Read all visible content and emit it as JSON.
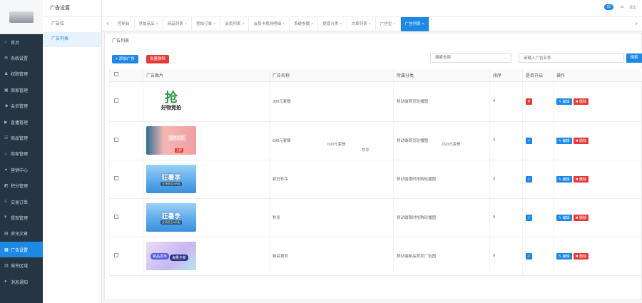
{
  "sidebar": {
    "items": [
      {
        "icon": "home-icon",
        "glyph": "⌂",
        "label": "首页"
      },
      {
        "icon": "gear-icon",
        "glyph": "⚙",
        "label": "系统设置"
      },
      {
        "icon": "users-icon",
        "glyph": "♟",
        "label": "权限管理"
      },
      {
        "icon": "shop-icon",
        "glyph": "▣",
        "label": "商家管理"
      },
      {
        "icon": "member-icon",
        "glyph": "☻",
        "label": "会员管理"
      },
      {
        "icon": "video-icon",
        "glyph": "▶",
        "label": "直播管理"
      },
      {
        "icon": "goods-icon",
        "glyph": "☷",
        "label": "商品管理"
      },
      {
        "icon": "store-icon",
        "glyph": "⌂",
        "label": "商家管理"
      },
      {
        "icon": "marketing-icon",
        "glyph": "✦",
        "label": "营销中心"
      },
      {
        "icon": "points-icon",
        "glyph": "◩",
        "label": "积分管理"
      },
      {
        "icon": "order-icon",
        "glyph": "≡",
        "label": "交易订单"
      },
      {
        "icon": "yen-icon",
        "glyph": "¥",
        "label": "提现管理"
      },
      {
        "icon": "article-icon",
        "glyph": "▤",
        "label": "资讯文章"
      },
      {
        "icon": "ad-icon",
        "glyph": "▦",
        "label": "广告设置"
      },
      {
        "icon": "region-icon",
        "glyph": "▥",
        "label": "城市区域"
      },
      {
        "icon": "notice-icon",
        "glyph": "●",
        "label": "消息通知"
      }
    ],
    "active_index": 13
  },
  "subnav": {
    "title": "广告设置",
    "items": [
      {
        "label": "广告位"
      },
      {
        "label": "广告列表"
      }
    ]
  },
  "topbar": {
    "badge": "10",
    "logout_label": "退出"
  },
  "tabs": [
    {
      "label": "控制台",
      "closable": false
    },
    {
      "label": "竞拍商品",
      "closable": true
    },
    {
      "label": "商品列表",
      "closable": true
    },
    {
      "label": "竞拍订单",
      "closable": true
    },
    {
      "label": "会员列表",
      "closable": true
    },
    {
      "label": "会员卡规则明细",
      "closable": true
    },
    {
      "label": "系统参数",
      "closable": true
    },
    {
      "label": "提现分类",
      "closable": true
    },
    {
      "label": "文章列表",
      "closable": true
    },
    {
      "label": "广告位",
      "closable": true
    },
    {
      "label": "广告列表",
      "closable": true,
      "active": true
    }
  ],
  "panel": {
    "title": "广告列表",
    "add_button": "+ 添加广告",
    "batch_delete_button": "批量删除",
    "select_value": "搜索全部",
    "search_placeholder": "请输入广告名称",
    "search_button": "搜索"
  },
  "table": {
    "headers": [
      "",
      "广告图片",
      "广告名称",
      "所属分类",
      "排序",
      "是否开启",
      "操作"
    ],
    "rows": [
      {
        "name": "390元套餐",
        "category": "移动端首页轮播图",
        "sort": "4",
        "enabled": false,
        "thumb": {
          "style": "logo",
          "line1": "抢",
          "line2": "好物竞拍"
        }
      },
      {
        "name": "690元套餐",
        "category": "移动端首页轮播图",
        "sort": "3",
        "enabled": true,
        "thumb": {
          "style": "banner",
          "line1": "服务之星",
          "line2": "立即"
        }
      },
      {
        "name": "疯狂秒杀",
        "category": "移动端限时抢购轮播图",
        "sort": "0",
        "enabled": true,
        "thumb": {
          "style": "summer",
          "line1": "狂暑季",
          "line2": "全场低至5折起"
        }
      },
      {
        "name": "秒杀",
        "category": "移动端限时抢购轮播图",
        "sort": "0",
        "enabled": true,
        "thumb": {
          "style": "summer",
          "line1": "狂暑季",
          "line2": "全场低至5折起"
        }
      },
      {
        "name": "新品首发",
        "category": "移动端新品首发广告图",
        "sort": "0",
        "enabled": true,
        "thumb": {
          "style": "newgoods",
          "line1": "新品发布",
          "line2": "海量全新"
        }
      }
    ],
    "edit_label": "✎ 编辑",
    "delete_label": "✖ 删除"
  },
  "ghost_texts": [
    "690元套餐",
    "秒杀",
    "690元套餐"
  ],
  "colors": {
    "primary": "#1e88e5",
    "danger": "#e53935",
    "sidebar": "#263544"
  }
}
